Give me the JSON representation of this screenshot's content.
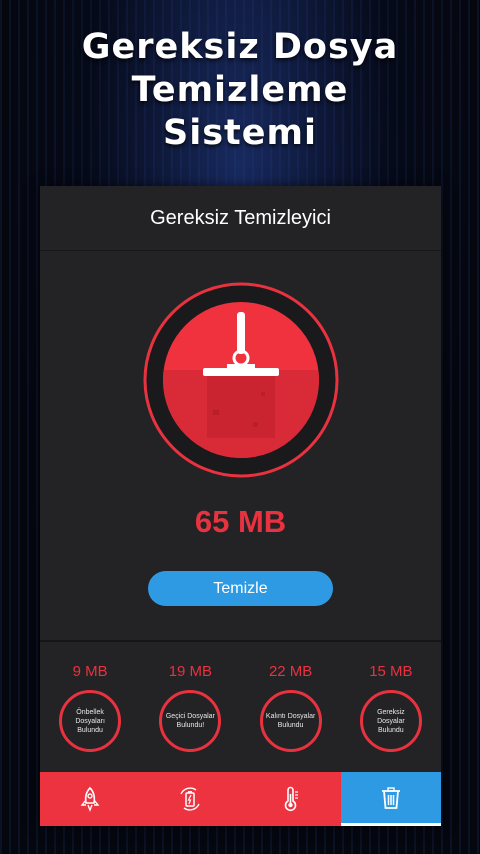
{
  "promo": {
    "title_line1": "Gereksiz Dosya",
    "title_line2": "Temizleme",
    "title_line3": "Sistemi"
  },
  "app": {
    "header_title": "Gereksiz Temizleyici",
    "junk_size": "65 MB",
    "clean_button_label": "Temizle"
  },
  "stats": [
    {
      "size": "9 MB",
      "label": "Önbellek Dosyaları Bulundu"
    },
    {
      "size": "19 MB",
      "label": "Geçici Dosyalar Bulundu!"
    },
    {
      "size": "22 MB",
      "label": "Kalıntı Dosyalar Bulundu"
    },
    {
      "size": "15 MB",
      "label": "Gereksiz Dosyalar Bulundu"
    }
  ],
  "bottom_nav": [
    {
      "icon": "rocket-icon",
      "active": false
    },
    {
      "icon": "battery-icon",
      "active": false
    },
    {
      "icon": "thermometer-icon",
      "active": false
    },
    {
      "icon": "trash-icon",
      "active": true
    }
  ],
  "colors": {
    "accent_red": "#e8323f",
    "accent_blue": "#2e9ae4",
    "panel_bg": "#232325"
  }
}
